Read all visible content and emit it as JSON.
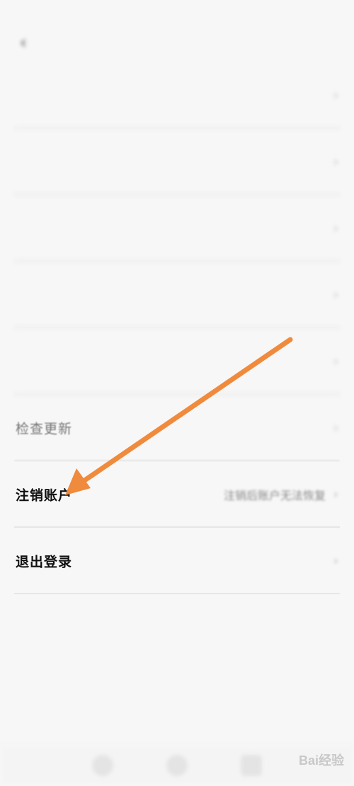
{
  "status_bar": {
    "left": "",
    "right": ""
  },
  "nav": {
    "title": ""
  },
  "rows": [
    {
      "label": "",
      "value": ""
    },
    {
      "label": "",
      "value": ""
    },
    {
      "label": "",
      "value": ""
    },
    {
      "label": "",
      "value": ""
    },
    {
      "label": "",
      "value": ""
    },
    {
      "label": "检查更新",
      "value": ""
    },
    {
      "label": "注销账户",
      "value": "注销后账户无法恢复"
    },
    {
      "label": "退出登录",
      "value": ""
    }
  ],
  "annotation": {
    "arrow_color": "#f08a3c"
  },
  "watermark": {
    "text": "Bai经验"
  },
  "icons": {
    "back": "chevron-left-icon",
    "row_chevron": "chevron-right-icon",
    "tabs": [
      "tab-home-icon",
      "tab-discover-icon",
      "tab-profile-icon"
    ]
  }
}
